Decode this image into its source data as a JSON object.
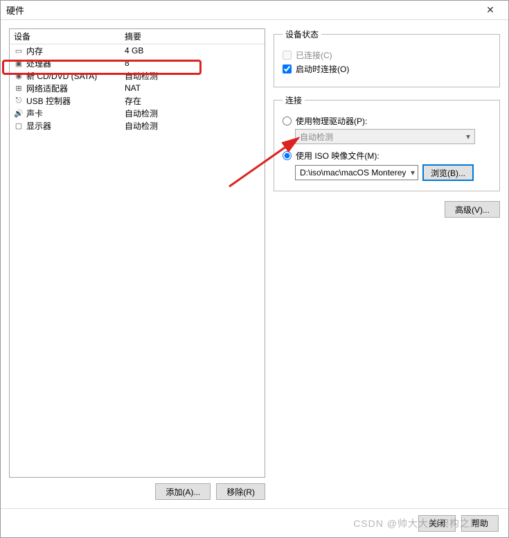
{
  "title": "硬件",
  "table": {
    "header_device": "设备",
    "header_summary": "摘要",
    "rows": [
      {
        "icon": "memory-icon",
        "device": "内存",
        "summary": "4 GB"
      },
      {
        "icon": "cpu-icon",
        "device": "处理器",
        "summary": "8"
      },
      {
        "icon": "cd-icon",
        "device": "新 CD/DVD (SATA)",
        "summary": "自动检测"
      },
      {
        "icon": "network-icon",
        "device": "网络适配器",
        "summary": "NAT"
      },
      {
        "icon": "usb-icon",
        "device": "USB 控制器",
        "summary": "存在"
      },
      {
        "icon": "sound-icon",
        "device": "声卡",
        "summary": "自动检测"
      },
      {
        "icon": "display-icon",
        "device": "显示器",
        "summary": "自动检测"
      }
    ]
  },
  "buttons": {
    "add": "添加(A)...",
    "remove": "移除(R)",
    "advanced": "高级(V)...",
    "browse": "浏览(B)...",
    "close": "关闭",
    "help": "帮助"
  },
  "status": {
    "legend": "设备状态",
    "connected": "已连接(C)",
    "connect_on_start": "启动时连接(O)"
  },
  "connection": {
    "legend": "连接",
    "physical": "使用物理驱动器(P):",
    "physical_value": "自动检测",
    "iso": "使用 ISO 映像文件(M):",
    "iso_value": "D:\\iso\\mac\\macOS Monterey"
  },
  "watermark": "CSDN @帅大大的架构之路"
}
